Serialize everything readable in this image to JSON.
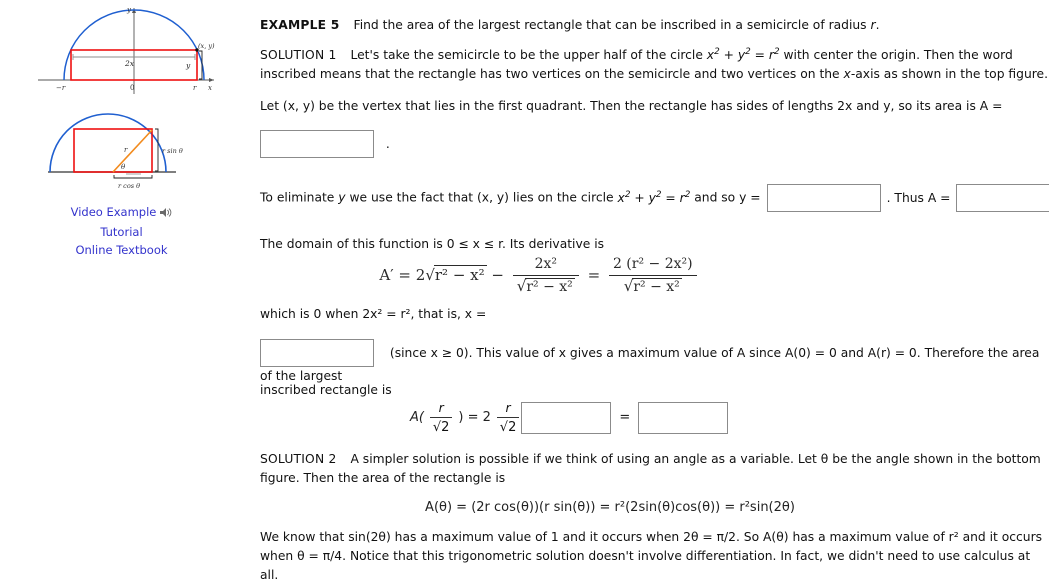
{
  "figures": {
    "top": {
      "name": "semicircle-rectangle-xy-figure",
      "labels": {
        "y_axis": "y",
        "x_axis": "x",
        "origin": "0",
        "left_tick": "−r",
        "right_tick": "r",
        "width_label": "2x",
        "height_label": "y",
        "vertex_label": "(x, y)"
      }
    },
    "bottom": {
      "name": "semicircle-rectangle-theta-figure",
      "labels": {
        "radius": "r",
        "angle": "θ",
        "vertical_side": "r sin θ",
        "horizontal_side": "r cos θ"
      }
    }
  },
  "links": [
    {
      "label": "Video Example",
      "icon": "speaker-icon",
      "has_icon": true
    },
    {
      "label": "Tutorial",
      "has_icon": false
    },
    {
      "label": "Online Textbook",
      "has_icon": false
    }
  ],
  "colors": {
    "link": "#3333cc",
    "curve_blue": "#1f5fd0",
    "rectangle_red": "#ee1111",
    "radius_orange": "#f28b1e",
    "axis_gray": "#555555",
    "box_border": "#8b8b8b"
  },
  "content": {
    "example_label": "EXAMPLE 5",
    "example_text_1": "Find the area of the largest rectangle that can be inscribed in a semicircle of radius ",
    "example_text_r": "r",
    "example_text_end": ".",
    "solution1_label": "SOLUTION 1",
    "solution1_part1": "Let's take the semicircle to be the upper half of the circle ",
    "solution1_eq": "x² + y² = r²",
    "solution1_part2": " with center the origin. Then the word inscribed means that the rectangle has two vertices on the semicircle and two vertices on the ",
    "solution1_part3": "x",
    "solution1_part4": "-axis as shown in the top figure.",
    "let_line": "Let (x, y) be the vertex that lies in the first quadrant. Then the rectangle has sides of lengths 2x and y, so its area is A =",
    "area_box_value": "",
    "area_box_period": ".",
    "eliminate_part1": "To eliminate ",
    "eliminate_y": "y",
    "eliminate_part2": " we use the fact that (x, y) lies on the circle ",
    "eliminate_eq": "x² + y² = r²",
    "eliminate_part3": " and so y =",
    "eliminate_box_value": "",
    "thus_text": ". Thus A =",
    "thus_box_value": "",
    "thus_period": ".",
    "domain_line": "The domain of this function is 0 ≤ x ≤ r. Its derivative is",
    "derivative": {
      "lhs": "A′ = 2",
      "radicand1": "r² − x²",
      "minus": "−",
      "frac1_num": "2x²",
      "frac1_den_radicand": "r² − x²",
      "equals": "=",
      "frac2_num": "2 (r² − 2x²)",
      "frac2_den_radicand": "r² − x²"
    },
    "whichis_line": "which is 0 when 2x² = r², that is, x =",
    "x_box_value": "",
    "since_line": "(since x ≥ 0). This value of x gives a maximum value of A since A(0) = 0 and A(r) = 0. Therefore the area of the largest",
    "inscribed_line": "inscribed rectangle is",
    "final_eq": {
      "a_open": "A(",
      "frac_num": "r",
      "frac_den": "√2",
      "a_close": ") = 2",
      "frac2_num": "r",
      "frac2_den": "√2",
      "box1_value": "",
      "equals": "=",
      "box2_value": ""
    },
    "solution2_label": "SOLUTION 2",
    "solution2_text": "A simpler solution is possible if we think of using an angle as a variable. Let θ be the angle shown in the bottom figure. Then the area of the rectangle is",
    "atheta_eq": "A(θ) = (2r cos(θ))(r sin(θ)) = r²(2sin(θ)cos(θ)) = r²sin(2θ)",
    "weknow_line": "We know that sin(2θ) has a maximum value of 1 and it occurs when 2θ = π/2. So A(θ) has a maximum value of r² and it occurs when θ = π/4. Notice that this trigonometric solution doesn't involve differentiation. In fact, we didn't need to use calculus at all."
  }
}
